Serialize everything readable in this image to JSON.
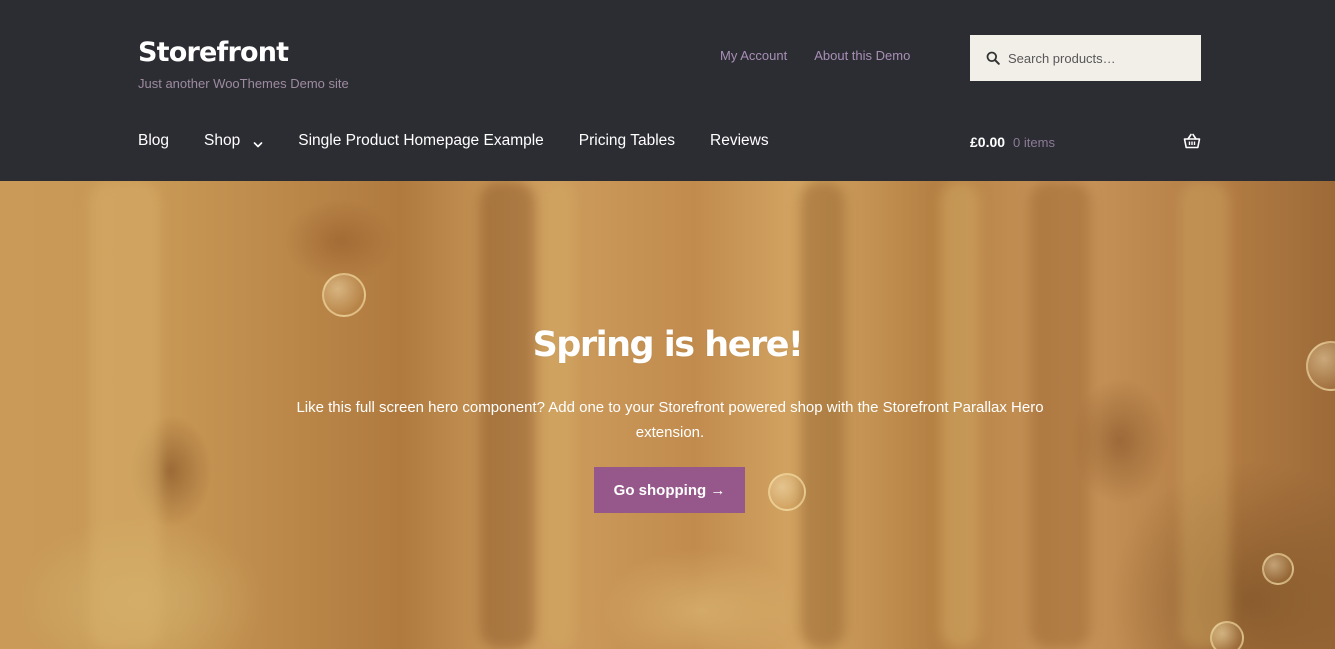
{
  "site": {
    "title": "Storefront",
    "description": "Just another WooThemes Demo site"
  },
  "secondary_nav": {
    "items": [
      "My Account",
      "About this Demo"
    ]
  },
  "search": {
    "placeholder": "Search products…",
    "icon": "search-icon"
  },
  "primary_nav": {
    "items": [
      {
        "label": "Blog"
      },
      {
        "label": "Shop",
        "icon": "chevron-down-icon"
      },
      {
        "label": "Single Product Homepage Example"
      },
      {
        "label": "Pricing Tables"
      },
      {
        "label": "Reviews"
      }
    ]
  },
  "cart": {
    "amount": "£0.00",
    "count": "0 items",
    "icon": "basket-icon"
  },
  "hero": {
    "title": "Spring is here!",
    "text": "Like this full screen hero component? Add one to your Storefront powered shop with the Storefront Parallax Hero extension.",
    "button_label": "Go shopping →"
  },
  "colors": {
    "header_bg": "#2c2d33",
    "accent": "#96588a",
    "secondary_link": "#a88fb6",
    "search_bg": "#f2efe9"
  }
}
